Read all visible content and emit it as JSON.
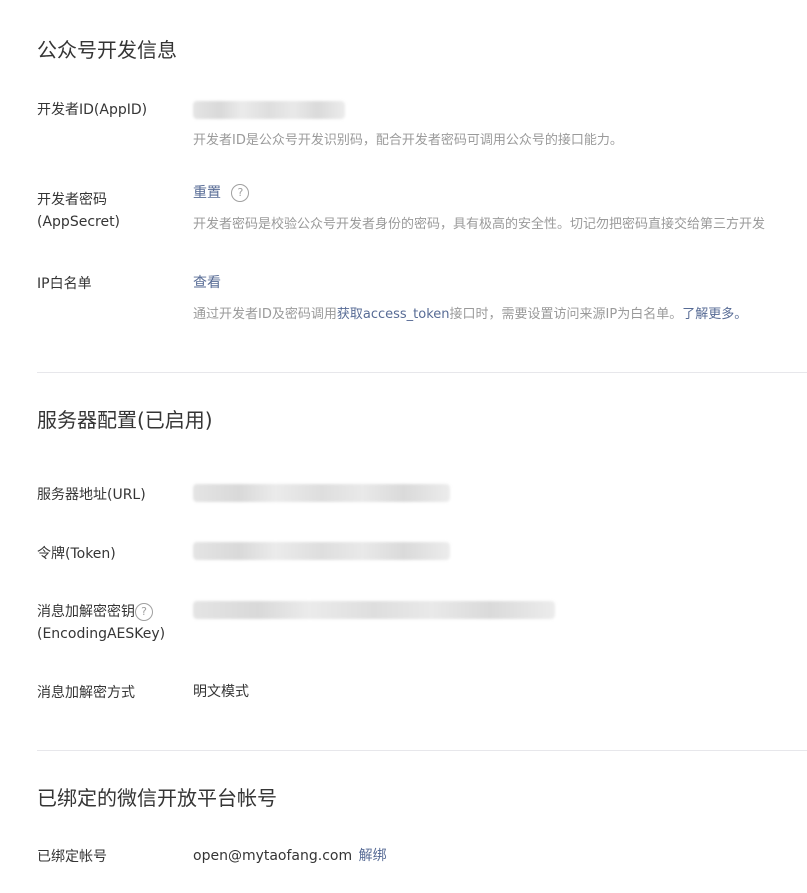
{
  "developer_info": {
    "title": "公众号开发信息",
    "appid": {
      "label": "开发者ID(AppID)",
      "desc": "开发者ID是公众号开发识别码，配合开发者密码可调用公众号的接口能力。"
    },
    "appsecret": {
      "label_line1": "开发者密码",
      "label_line2": "(AppSecret)",
      "action": "重置",
      "help_glyph": "?",
      "desc": "开发者密码是校验公众号开发者身份的密码，具有极高的安全性。切记勿把密码直接交给第三方开发"
    },
    "ip_whitelist": {
      "label": "IP白名单",
      "action": "查看",
      "desc_pre": "通过开发者ID及密码调用",
      "desc_link": "获取access_token",
      "desc_mid": "接口时，需要设置访问来源IP为白名单。",
      "desc_more": "了解更多。"
    }
  },
  "server_config": {
    "title": "服务器配置(已启用)",
    "url": {
      "label": "服务器地址(URL)"
    },
    "token": {
      "label": "令牌(Token)"
    },
    "aeskey": {
      "label_line1": "消息加解密密钥",
      "label_line2": "(EncodingAESKey)",
      "help_glyph": "?"
    },
    "mode": {
      "label": "消息加解密方式",
      "value": "明文模式"
    }
  },
  "open_platform": {
    "title": "已绑定的微信开放平台帐号",
    "bound": {
      "label": "已绑定帐号",
      "value": "open@mytaofang.com",
      "action": "解绑"
    }
  },
  "colors": {
    "link": "#576b95",
    "description": "#9a9a9a",
    "divider": "#e7e7eb",
    "text": "#353535"
  }
}
